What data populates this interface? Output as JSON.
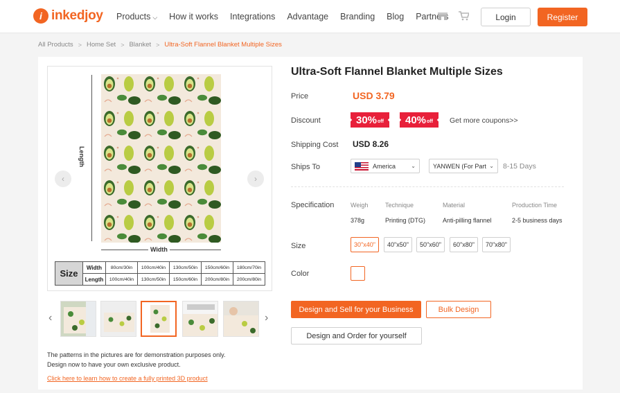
{
  "header": {
    "brand": "inkedjoy",
    "nav": [
      {
        "label": "Products",
        "dropdown": true
      },
      {
        "label": "How it works"
      },
      {
        "label": "Integrations"
      },
      {
        "label": "Advantage"
      },
      {
        "label": "Branding"
      },
      {
        "label": "Blog"
      },
      {
        "label": "Partners"
      }
    ],
    "icons": [
      "store-icon",
      "cart-icon"
    ],
    "login_label": "Login",
    "register_label": "Register"
  },
  "breadcrumb": [
    "All Products",
    "Home Set",
    "Blanket",
    "Ultra-Soft Flannel Blanket Multiple Sizes"
  ],
  "gallery": {
    "length_label": "Length",
    "width_label": "Width",
    "size_table": {
      "head": "Size",
      "rows": [
        {
          "label": "Width",
          "cells": [
            "80cm/30in",
            "100cm/40in",
            "130cm/50in",
            "150cm/60in",
            "180cm/70in"
          ]
        },
        {
          "label": "Length",
          "cells": [
            "100cm/40in",
            "130cm/50in",
            "150cm/60in",
            "200cm/80in",
            "200cm/80in"
          ]
        }
      ]
    },
    "note_line1": "The patterns in the pictures are for demonstration purposes only.",
    "note_line2": "Design now to have your own exclusive product.",
    "link": "Click here to learn how to create a fully printed 3D product"
  },
  "product": {
    "title": "Ultra-Soft Flannel Blanket Multiple Sizes",
    "price_label": "Price",
    "price": "USD 3.79",
    "discount_label": "Discount",
    "coupons": [
      {
        "value": "30%",
        "suffix": "off"
      },
      {
        "value": "40%",
        "suffix": "off"
      }
    ],
    "more_coupons": "Get more coupons>>",
    "shipping_cost_label": "Shipping Cost",
    "shipping_cost": "USD 8.26",
    "ships_to_label": "Ships To",
    "country": "America",
    "carrier": "YANWEN (For Part",
    "delivery_days": "8-15 Days",
    "specification_label": "Specification",
    "spec": [
      {
        "head": "Weigh",
        "value": "378g"
      },
      {
        "head": "Technique",
        "value": "Printing (DTG)"
      },
      {
        "head": "Material",
        "value": "Anti-pilling flannel"
      },
      {
        "head": "Production Time",
        "value": "2-5 business days"
      }
    ],
    "size_label": "Size",
    "sizes": [
      "30\"x40\"",
      "40\"x50\"",
      "50\"x60\"",
      "60\"x80\"",
      "70\"x80\""
    ],
    "selected_size": "30\"x40\"",
    "color_label": "Color",
    "btn_design_sell": "Design and Sell for your Business",
    "btn_bulk": "Bulk Design",
    "btn_design_order": "Design and Order for yourself"
  },
  "colors": {
    "accent": "#f26522",
    "coupon": "#e8203a"
  }
}
